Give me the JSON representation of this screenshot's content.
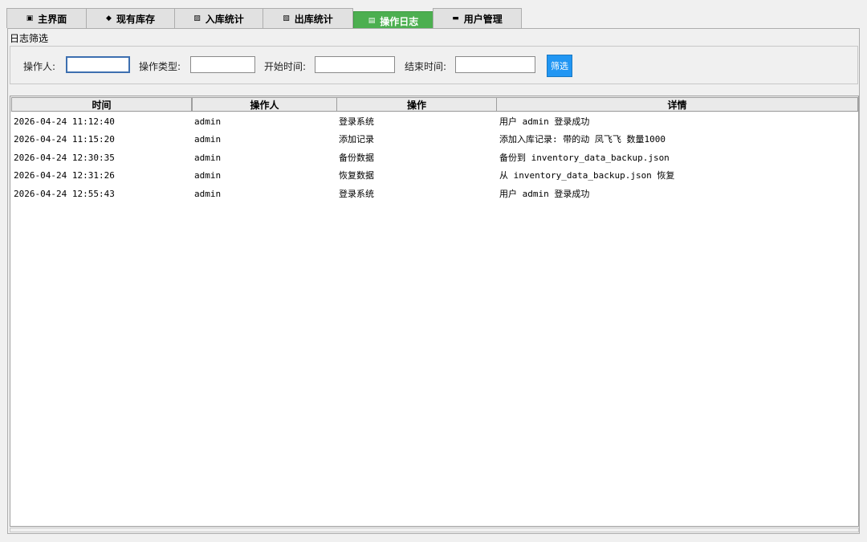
{
  "tabs": [
    {
      "label": "主界面",
      "icon": "▣",
      "active": false
    },
    {
      "label": "现有库存",
      "icon": "◆",
      "active": false
    },
    {
      "label": "入库统计",
      "icon": "▨",
      "active": false
    },
    {
      "label": "出库统计",
      "icon": "▧",
      "active": false
    },
    {
      "label": "操作日志",
      "icon": "▤",
      "active": true
    },
    {
      "label": "用户管理",
      "icon": "▬",
      "active": false
    }
  ],
  "filter": {
    "group_label": "日志筛选",
    "operator_label": "操作人:",
    "operator_value": "",
    "type_label": "操作类型:",
    "type_value": "",
    "start_label": "开始时间:",
    "start_value": "",
    "end_label": "结束时间:",
    "end_value": "",
    "button_label": "筛选"
  },
  "table": {
    "columns": [
      "时间",
      "操作人",
      "操作",
      "详情"
    ],
    "rows": [
      [
        "2026-04-24 11:12:40",
        "admin",
        "登录系统",
        "用户 admin 登录成功"
      ],
      [
        "2026-04-24 11:15:20",
        "admin",
        "添加记录",
        "添加入库记录: 带的动 凤飞飞 数量1000"
      ],
      [
        "2026-04-24 12:30:35",
        "admin",
        "备份数据",
        "备份到 inventory_data_backup.json"
      ],
      [
        "2026-04-24 12:31:26",
        "admin",
        "恢复数据",
        "从 inventory_data_backup.json 恢复"
      ],
      [
        "2026-04-24 12:55:43",
        "admin",
        "登录系统",
        "用户 admin 登录成功"
      ]
    ]
  }
}
